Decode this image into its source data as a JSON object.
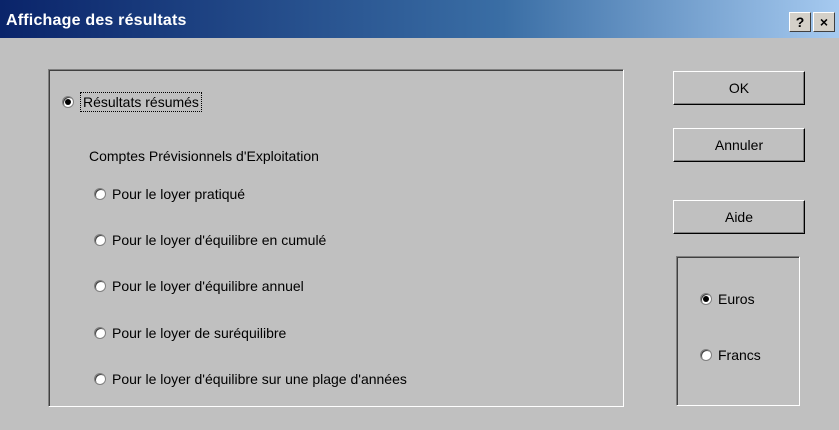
{
  "window": {
    "title": "Affichage des résultats",
    "help_glyph": "?",
    "close_glyph": "×"
  },
  "options": {
    "summary_label": "Résultats résumés",
    "section_heading": "Comptes Prévisionnels d'Exploitation",
    "items": [
      {
        "label": "Pour le loyer pratiqué"
      },
      {
        "label": "Pour le loyer d'équilibre en cumulé"
      },
      {
        "label": "Pour le loyer d'équilibre annuel"
      },
      {
        "label": "Pour le loyer de suréquilibre"
      },
      {
        "label": "Pour le loyer d'équilibre sur une plage d'années"
      }
    ]
  },
  "buttons": {
    "ok": "OK",
    "cancel": "Annuler",
    "help": "Aide"
  },
  "currency": {
    "euros": "Euros",
    "francs": "Francs"
  },
  "colors": {
    "title_start": "#0a246a",
    "title_end": "#a6caf0",
    "window_bg": "#c0c0c0"
  }
}
